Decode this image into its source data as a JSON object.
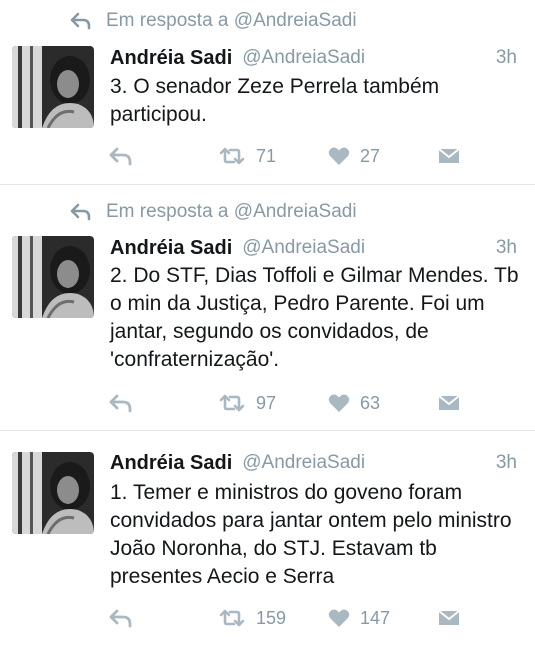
{
  "tweets": [
    {
      "reply_context": "Em resposta a @AndreiaSadi",
      "name": "Andréia Sadi",
      "handle": "@AndreiaSadi",
      "time": "3h",
      "text": "3. O senador Zeze Perrela também participou.",
      "retweets": "71",
      "likes": "27"
    },
    {
      "reply_context": "Em resposta a @AndreiaSadi",
      "name": "Andréia Sadi",
      "handle": "@AndreiaSadi",
      "time": "3h",
      "text": "2. Do STF, Dias Toffoli e Gilmar Mendes. Tb o min da Justiça, Pedro Parente. Foi um jantar, segundo os convidados, de 'confraternização'.",
      "retweets": "97",
      "likes": "63"
    },
    {
      "name": "Andréia Sadi",
      "handle": "@AndreiaSadi",
      "time": "3h",
      "text": "1. Temer e ministros do goveno foram convidados para jantar ontem pelo ministro João Noronha, do STJ. Estavam tb presentes Aecio e Serra",
      "retweets": "159",
      "likes": "147"
    }
  ],
  "icons": {
    "reply": "reply-icon",
    "retweet": "retweet-icon",
    "like": "heart-icon",
    "message": "direct-message-icon",
    "context": "reply-arrow-icon"
  },
  "colors": {
    "text": "#14171a",
    "muted": "#8899a6",
    "icon": "#aab8c2",
    "divider": "#e1e8ed"
  }
}
